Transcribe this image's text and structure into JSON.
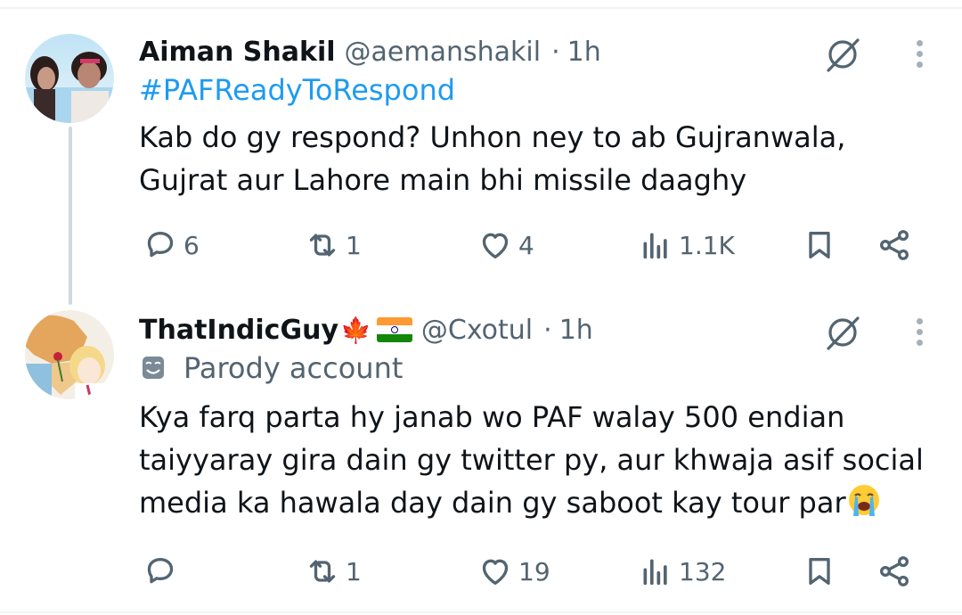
{
  "tweets": [
    {
      "author_name": "Aiman Shakil",
      "handle": "@aemanshakil",
      "separator": "·",
      "time": "1h",
      "hashtag": "#PAFReadyToRespond",
      "text_lines": [
        "Kab do gy respond? Unhon ney to ab Gujranwala,",
        "Gujrat aur Lahore main bhi missile daaghy"
      ],
      "replies": "6",
      "reposts": "1",
      "likes": "4",
      "views": "1.1K",
      "icons": [
        "grok-icon",
        "more-icon",
        "reply-icon",
        "repost-icon",
        "like-icon",
        "views-icon",
        "bookmark-icon",
        "share-icon"
      ]
    },
    {
      "author_name": "ThatIndicGuy",
      "name_emojis": [
        "maple-leaf",
        "india-flag"
      ],
      "maple_glyph": "🍁",
      "handle": "@Cxotul",
      "separator": "·",
      "time": "1h",
      "account_label": "Parody account",
      "text_lines": [
        "Kya farq parta hy janab wo PAF walay 500 endian",
        "taiyyaray gira dain gy twitter py, aur khwaja asif social",
        "media ka hawala day dain gy saboot kay tour par"
      ],
      "trailing_emoji": "loudly-crying-face",
      "replies": "",
      "reposts": "1",
      "likes": "19",
      "views": "132",
      "icons": [
        "grok-icon",
        "more-icon",
        "reply-icon",
        "repost-icon",
        "like-icon",
        "views-icon",
        "bookmark-icon",
        "share-icon"
      ]
    }
  ],
  "colors": {
    "text": "#0f1419",
    "secondary": "#536471",
    "link": "#1d9bf0",
    "divider": "#eff3f4",
    "thread_line": "#cfd9de"
  }
}
